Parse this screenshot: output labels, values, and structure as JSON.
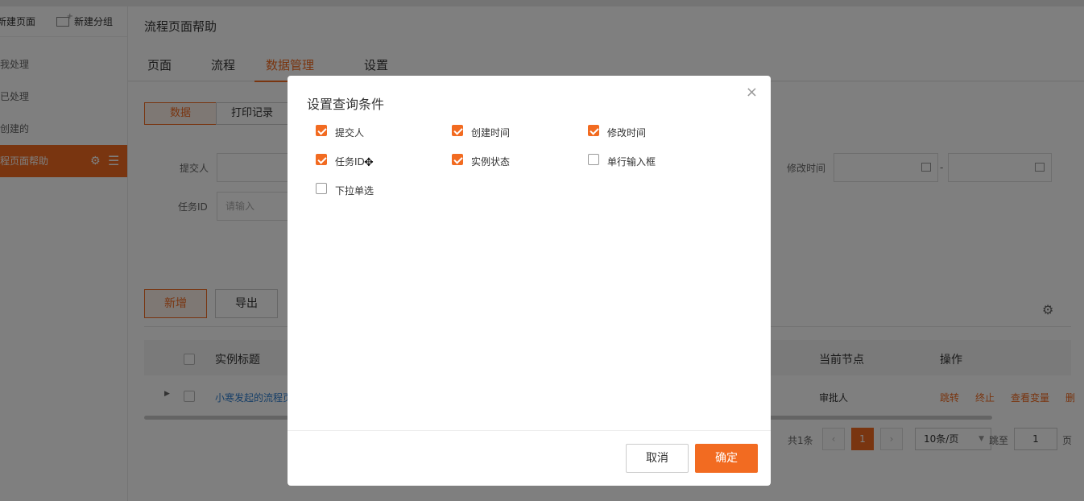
{
  "sidebar": {
    "new_page": "新建页面",
    "new_group": "新建分组",
    "items": [
      {
        "label": "待我处理"
      },
      {
        "label": "我已处理"
      },
      {
        "label": "我创建的"
      },
      {
        "label": "流程页面帮助"
      }
    ]
  },
  "header": {
    "title": "流程页面帮助",
    "tabs": [
      {
        "label": "页面"
      },
      {
        "label": "流程"
      },
      {
        "label": "数据管理"
      },
      {
        "label": "设置"
      }
    ]
  },
  "content": {
    "segments": [
      {
        "label": "数据"
      },
      {
        "label": "打印记录"
      }
    ],
    "filters": {
      "submitter_label": "提交人",
      "task_id_label": "任务ID",
      "task_id_placeholder": "请输入",
      "modified_time_label": "修改时间",
      "range_sep": "-"
    },
    "actions": {
      "add": "新增",
      "export": "导出"
    },
    "table": {
      "headers": {
        "title": "实例标题",
        "current_node": "当前节点",
        "operation": "操作"
      },
      "rows": [
        {
          "title": "小寒发起的流程页",
          "current_node": "审批人",
          "ops": [
            "跳转",
            "终止",
            "查看变量",
            "删"
          ]
        }
      ]
    },
    "pagination": {
      "total": "共1条",
      "current": "1",
      "page_size": "10条/页",
      "jump_label": "跳至",
      "jump_value": "1",
      "page_unit": "页"
    }
  },
  "dialog": {
    "title": "设置查询条件",
    "close": "×",
    "options": [
      {
        "label": "提交人",
        "checked": true
      },
      {
        "label": "创建时间",
        "checked": true
      },
      {
        "label": "修改时间",
        "checked": true
      },
      {
        "label": "任务ID",
        "checked": true
      },
      {
        "label": "实例状态",
        "checked": true
      },
      {
        "label": "单行输入框",
        "checked": false
      },
      {
        "label": "下拉单选",
        "checked": false
      }
    ],
    "cancel": "取消",
    "confirm": "确定"
  },
  "colors": {
    "accent": "#f26b21",
    "link": "#2f7fd0"
  }
}
